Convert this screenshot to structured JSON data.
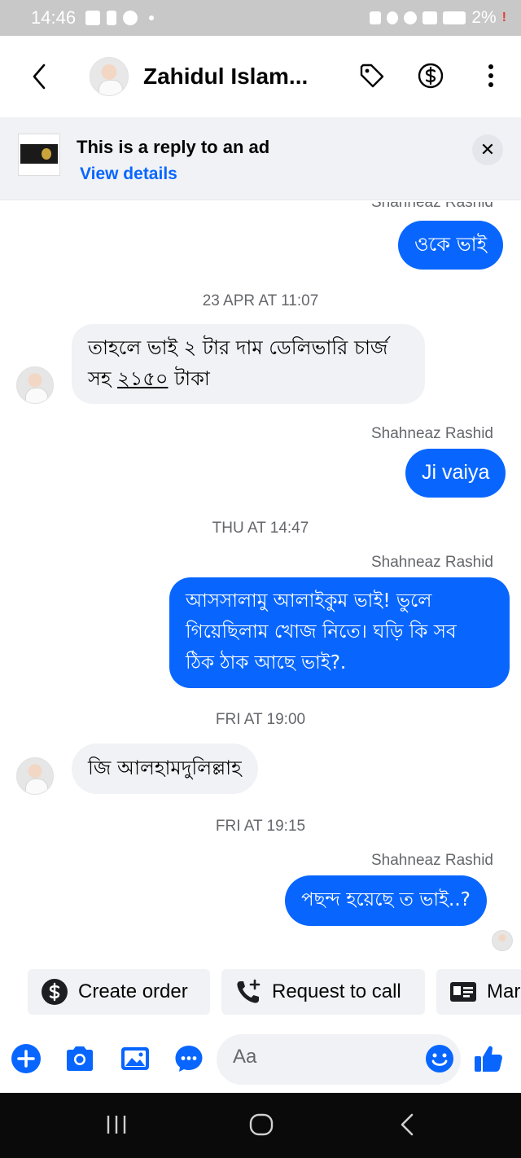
{
  "status_bar": {
    "time": "14:46",
    "battery": "2%"
  },
  "header": {
    "contact_name": "Zahidul Islam...",
    "icons": [
      "back-chevron-icon",
      "tag-icon",
      "dollar-circle-icon",
      "more-vertical-icon"
    ]
  },
  "ad_banner": {
    "title": "This is a reply to an ad",
    "link": "View details"
  },
  "messages": [
    {
      "sender": "Shahneaz Rashid",
      "text": "ওকে ভাই",
      "direction": "out"
    },
    {
      "timestamp": "23 APR AT 11:07"
    },
    {
      "text_line1": "তাহলে ভাই ২ টার দাম ডেলিভারি চার্জ",
      "text_line2_a": "সহ ",
      "text_line2_b": "২১৫০",
      "text_line2_c": " টাকা",
      "direction": "in"
    },
    {
      "sender": "Shahneaz Rashid"
    },
    {
      "text": "Ji vaiya",
      "direction": "out"
    },
    {
      "timestamp": "THU AT 14:47"
    },
    {
      "sender": "Shahneaz Rashid"
    },
    {
      "text_line1": "আসসালামু আলাইকুম  ভাই! ভুলে",
      "text_line2": "গিয়েছিলাম খোজ নিতে। ঘড়ি কি সব",
      "text_line3": "ঠিক ঠাক আছে ভাই?.",
      "direction": "out"
    },
    {
      "timestamp": "FRI AT 19:00"
    },
    {
      "text": "জি আলহামদুলিল্লাহ",
      "direction": "in"
    },
    {
      "timestamp": "FRI AT 19:15"
    },
    {
      "sender": "Shahneaz Rashid"
    },
    {
      "text": "পছন্দ হয়েছে ত ভাই..?",
      "direction": "out"
    }
  ],
  "chips": {
    "create_order": "Create order",
    "request_call": "Request to call",
    "mark": "Mar"
  },
  "composer": {
    "placeholder": "Aa"
  },
  "colors": {
    "accent": "#0866ff",
    "incoming_bubble": "#f0f2f5",
    "status_bar": "#c8c8c8"
  }
}
